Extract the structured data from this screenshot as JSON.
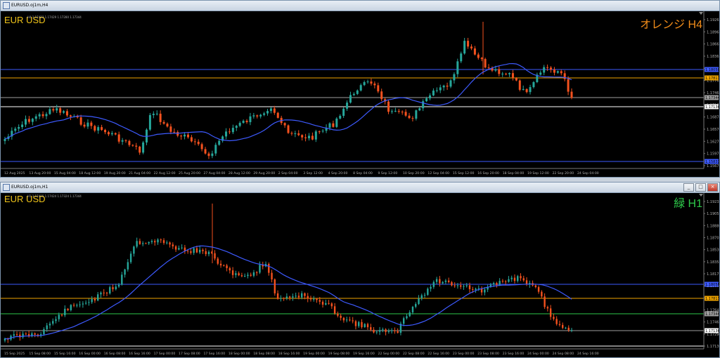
{
  "colors": {
    "bull": "#26a69a",
    "bear": "#f4511e",
    "ma": "#3d5afe",
    "bg": "#000000",
    "grid_text": "#b0b0b0"
  },
  "top": {
    "title": "EURUSD.oj1m,H4",
    "symbol": "EUR USD",
    "ohlc": "H4 1.17423 1.17429 1.17280 1.17344",
    "tag": "オレンジ H4",
    "prices": [
      "1.19263",
      "1.18963",
      "1.18665",
      "1.18365",
      "1.18066",
      "1.17763",
      "1.17465",
      "1.17165",
      "1.16878",
      "1.16578",
      "1.16278",
      "1.15978",
      "1.15678"
    ],
    "price_tags": [
      {
        "label": "1.18058",
        "color": "#3d5afe"
      },
      {
        "label": "1.17817",
        "color": "#f0a500"
      },
      {
        "label": "1.17344",
        "color": "#9e9e9e"
      },
      {
        "label": "1.17136",
        "color": "#ffffff"
      },
      {
        "label": "1.15831",
        "color": "#3d5afe"
      }
    ],
    "times": [
      "12 Aug 2025",
      "13 Aug 20:00",
      "15 Aug 04:00",
      "18 Aug 12:00",
      "19 Aug 20:00",
      "21 Aug 04:00",
      "22 Aug 12:00",
      "25 Aug 20:00",
      "27 Aug 04:00",
      "28 Aug 12:00",
      "29 Aug 20:00",
      "2 Sep 04:00",
      "3 Sep 12:00",
      "4 Sep 20:00",
      "8 Sep 04:00",
      "9 Sep 12:00",
      "10 Sep 20:00",
      "12 Sep 04:00",
      "15 Sep 12:00",
      "16 Sep 20:00",
      "18 Sep 04:00",
      "19 Sep 12:00",
      "22 Sep 20:00",
      "24 Sep 04:00"
    ],
    "window_buttons": [
      "_",
      "□",
      "×"
    ]
  },
  "bottom": {
    "title": "EURUSD.oj1m,H1",
    "symbol": "EUR USD",
    "ohlc": "H1 1.17415 1.17424 1.17324 1.17344",
    "tag": "緑 H1",
    "prices": [
      "1.19235",
      "1.19055",
      "1.18880",
      "1.18705",
      "1.18530",
      "1.18355",
      "1.18175",
      "1.18000",
      "1.17815",
      "1.17645",
      "1.17465",
      "1.17290",
      "1.17136"
    ],
    "price_tags": [
      {
        "label": "1.18058",
        "color": "#3d5afe"
      },
      {
        "label": "1.17813",
        "color": "#f0a500"
      },
      {
        "label": "1.17344",
        "color": "#9e9e9e"
      },
      {
        "label": "1.17136",
        "color": "#ffffff"
      }
    ],
    "times": [
      "15 Sep 2025",
      "15 Sep 08:00",
      "15 Sep 16:00",
      "16 Sep 00:00",
      "16 Sep 08:00",
      "16 Sep 16:00",
      "17 Sep 00:00",
      "17 Sep 08:00",
      "17 Sep 16:00",
      "18 Sep 00:00",
      "18 Sep 08:00",
      "18 Sep 16:00",
      "19 Sep 00:00",
      "19 Sep 08:00",
      "19 Sep 16:00",
      "22 Sep 00:00",
      "22 Sep 08:00",
      "22 Sep 16:00",
      "23 Sep 00:00",
      "23 Sep 08:00",
      "23 Sep 16:00",
      "24 Sep 00:00",
      "24 Sep 08:00",
      "24 Sep 16:00"
    ],
    "window_buttons": [
      "_",
      "□",
      "×"
    ]
  }
}
